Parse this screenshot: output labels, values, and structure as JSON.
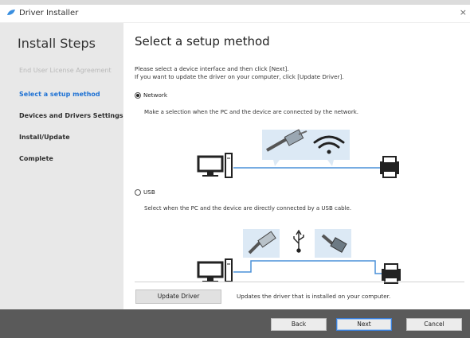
{
  "window": {
    "title": "Driver Installer",
    "close_glyph": "×"
  },
  "sidebar": {
    "heading": "Install Steps",
    "steps": [
      {
        "label": "End User License Agreement",
        "state": "done"
      },
      {
        "label": "Select a setup method",
        "state": "current"
      },
      {
        "label": "Devices and Drivers Settings",
        "state": "pending"
      },
      {
        "label": "Install/Update",
        "state": "pending"
      },
      {
        "label": "Complete",
        "state": "pending"
      }
    ]
  },
  "main": {
    "heading": "Select a setup method",
    "instruction_line1": "Please select a device interface and then click [Next].",
    "instruction_line2": "If you want to update the driver on your computer, click [Update Driver].",
    "options": [
      {
        "label": "Network",
        "selected": true,
        "description": "Make a selection when the PC and the device are connected by the network."
      },
      {
        "label": "USB",
        "selected": false,
        "description": "Select when the PC and the device are directly connected by a USB cable."
      }
    ],
    "update_driver_label": "Update Driver",
    "update_driver_desc": "Updates the driver that is installed on your computer."
  },
  "footer": {
    "back_label": "Back",
    "next_label": "Next",
    "cancel_label": "Cancel"
  },
  "colors": {
    "accent": "#1f72d4",
    "sidebar_bg": "#e8e8e8",
    "footer_bg": "#5a5a5a",
    "line": "#4a90d9",
    "illus_bg": "#dce9f5"
  },
  "icons": [
    "installer-logo-icon",
    "radio-icon",
    "computer-icon",
    "printer-icon",
    "ethernet-cable-icon",
    "wifi-icon",
    "usb-a-plug-icon",
    "usb-symbol-icon",
    "usb-b-plug-icon"
  ]
}
